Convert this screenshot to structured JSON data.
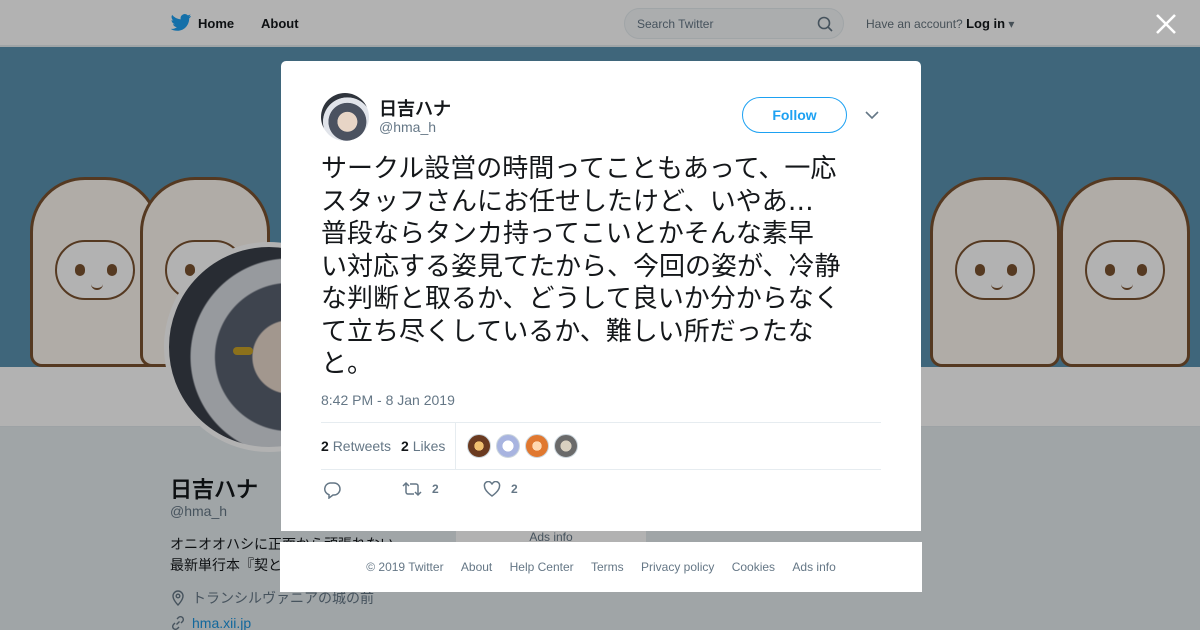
{
  "nav": {
    "home_label": "Home",
    "about_label": "About",
    "search_placeholder": "Search Twitter",
    "account_prompt": "Have an account?",
    "login_label": "Log in"
  },
  "profile": {
    "name": "日吉ハナ",
    "handle": "@hma_h",
    "bio_line1": "オニオオハシに正面から頑張れない",
    "bio_line2": "最新単行本『契と",
    "location": "トランシルヴァニアの城の前",
    "url": "hma.xii.jp",
    "ads_info": "Ads info"
  },
  "tweet": {
    "author_name": "日吉ハナ",
    "author_handle": "@hma_h",
    "follow_label": "Follow",
    "lines": [
      "サークル設営の時間ってこともあって、一応",
      "スタッフさんにお任せしたけど、いやあ…",
      "普段ならタンカ持ってこいとかそんな素早",
      "い対応する姿見てたから、今回の姿が、冷静",
      "な判断と取るか、どうして良いか分からなく",
      "て立ち尽くしているか、難しい所だったな",
      "と。"
    ],
    "timestamp": "8:42 PM - 8 Jan 2019",
    "retweets_count": "2",
    "retweets_label": "Retweets",
    "likes_count": "2",
    "likes_label": "Likes",
    "action_retweet_count": "2",
    "action_like_count": "2"
  },
  "footer": {
    "copyright": "© 2019 Twitter",
    "about": "About",
    "help": "Help Center",
    "terms": "Terms",
    "privacy": "Privacy policy",
    "cookies": "Cookies",
    "ads": "Ads info"
  },
  "icons": {
    "brand": "twitter-bird-icon",
    "search": "search-icon",
    "close": "close-icon",
    "caret": "chevron-down-icon",
    "reply": "reply-icon",
    "retweet": "retweet-icon",
    "like": "heart-icon",
    "location": "location-pin-icon",
    "link": "link-icon"
  },
  "colors": {
    "brand_blue": "#1da1f2",
    "banner_blue": "#5b93b0",
    "muted_text": "#657786"
  }
}
